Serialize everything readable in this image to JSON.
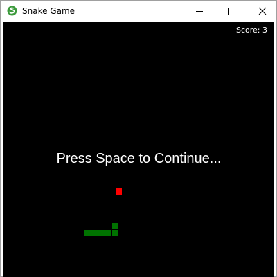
{
  "window": {
    "title": "Snake Game",
    "icon": "snake-game-app-icon",
    "controls": [
      "minimize-icon",
      "maximize-icon",
      "close-icon"
    ]
  },
  "game": {
    "score_text": "Score: 3",
    "score": 3,
    "message": "Press Space to Continue...",
    "state": "paused",
    "background_color": "#000000",
    "food": {
      "col": 16,
      "row": 24,
      "color": "#ff0000"
    },
    "snake": {
      "color": "#007300",
      "segments": [
        {
          "col": 16,
          "row": 29
        },
        {
          "col": 16,
          "row": 30
        },
        {
          "col": 15,
          "row": 30
        },
        {
          "col": 14,
          "row": 30
        },
        {
          "col": 13,
          "row": 30
        },
        {
          "col": 12,
          "row": 30
        }
      ]
    }
  }
}
